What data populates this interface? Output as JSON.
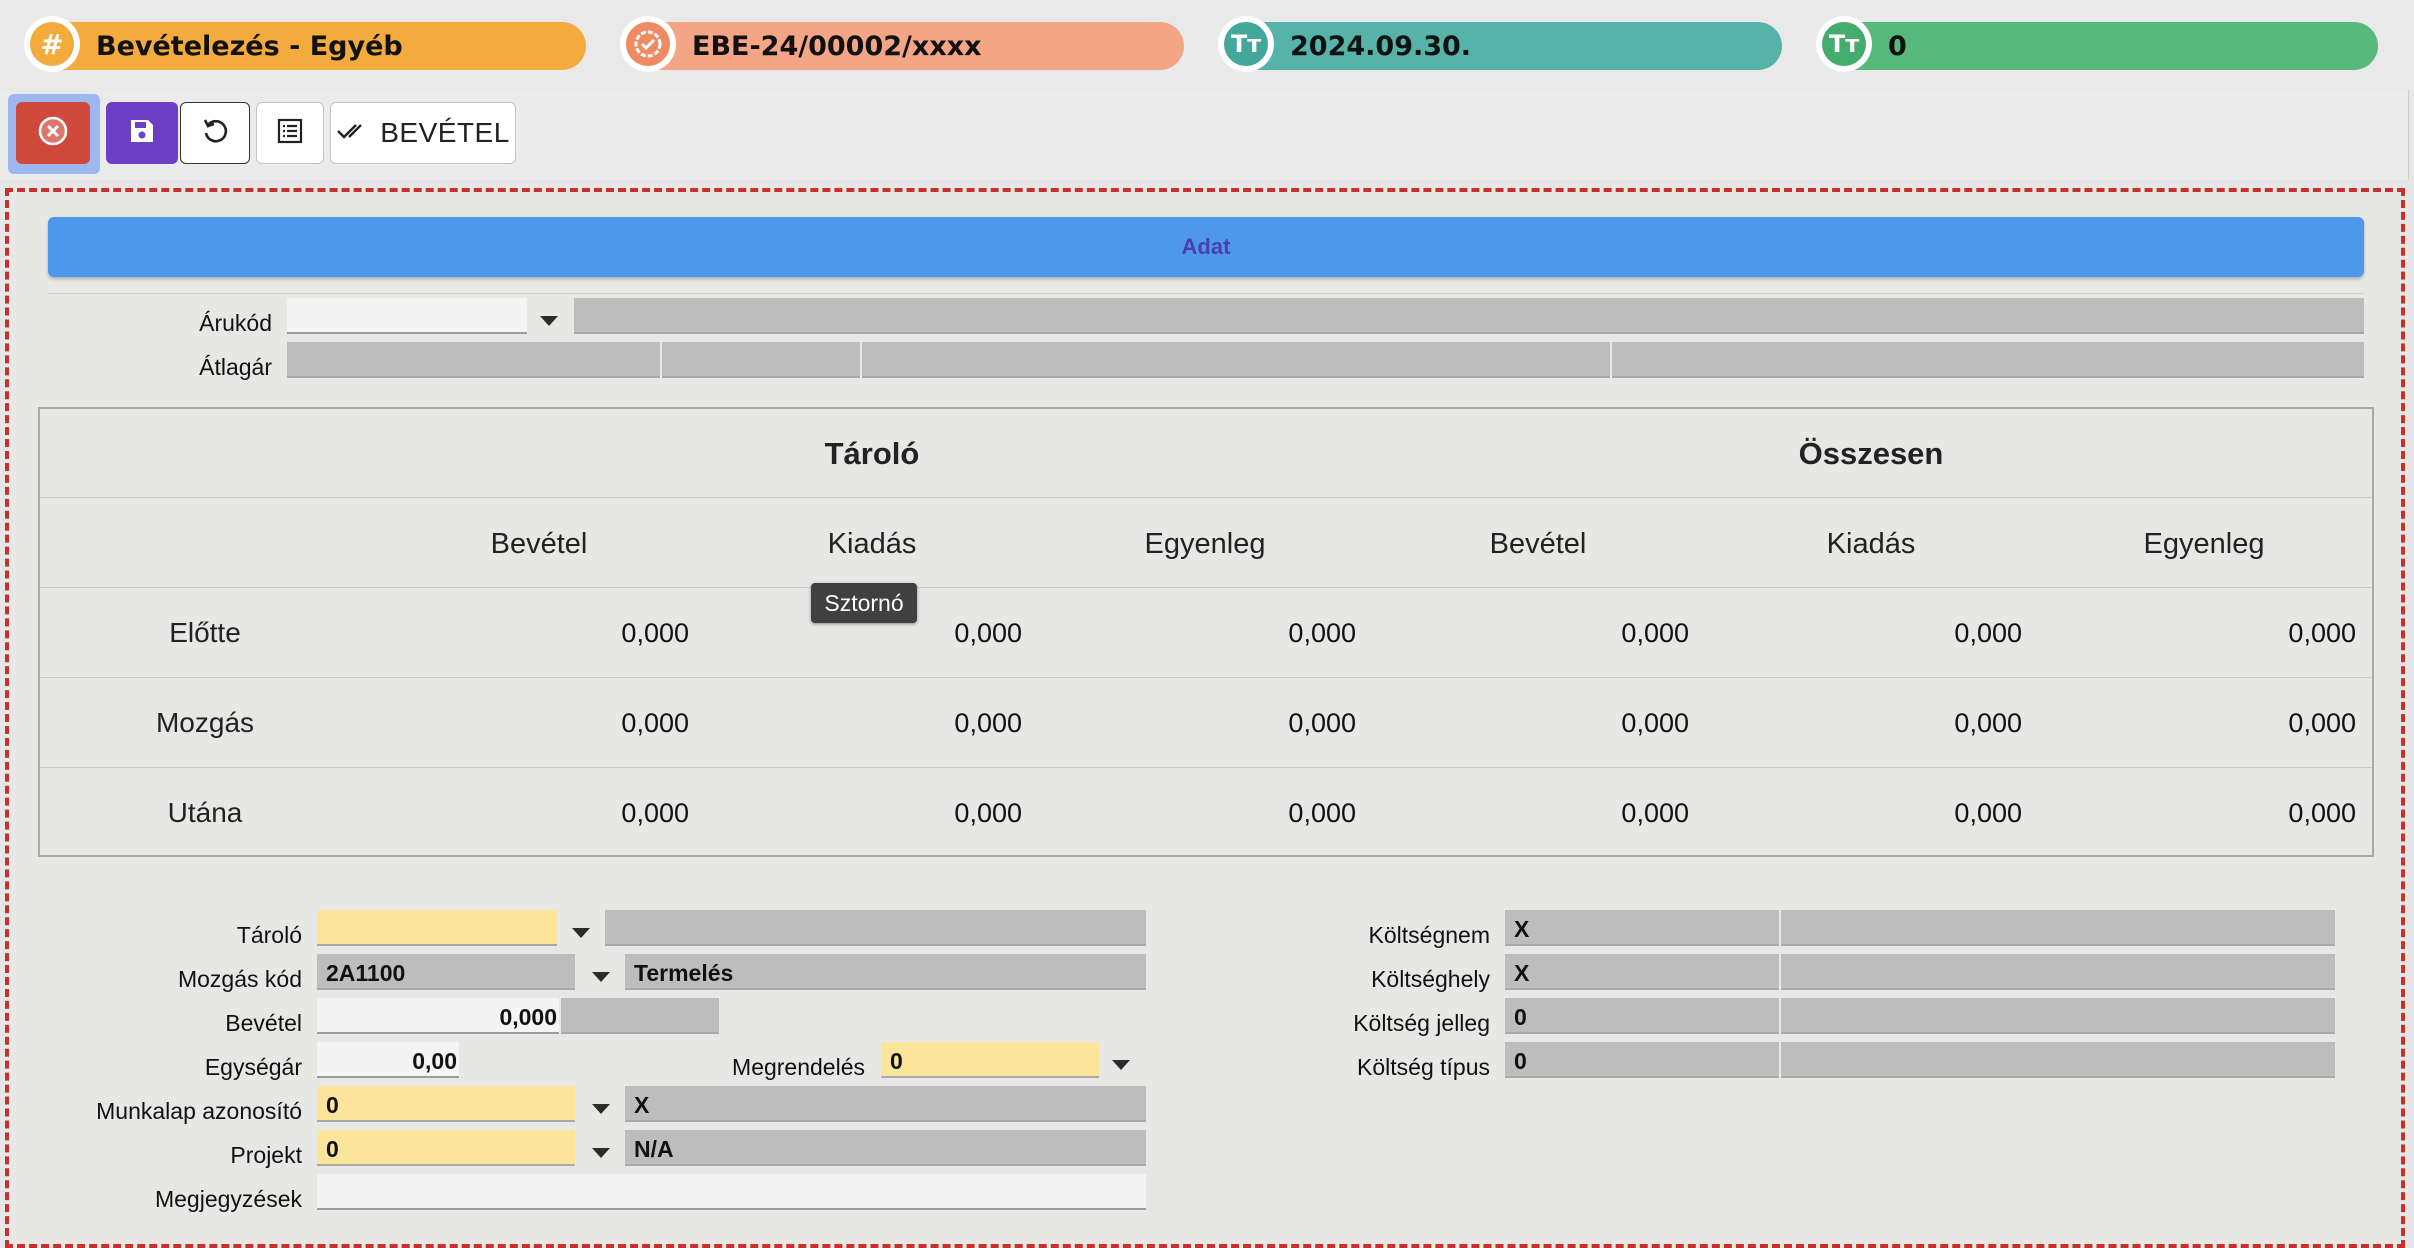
{
  "header": {
    "pills": [
      {
        "icon": "hash-icon",
        "text": "Bevételezés - Egyéb",
        "color": "#f2ab3c",
        "icon_color": "#f2ab3c",
        "glyph": "#"
      },
      {
        "icon": "check-badge-icon",
        "text": "EBE-24/00002/xxxx",
        "color": "#f3a585",
        "icon_color": "#f08a63",
        "glyph": "✓"
      },
      {
        "icon": "text-type-icon",
        "text": "2024.09.30.",
        "color": "#55b3a9",
        "icon_color": "#44a79b",
        "glyph": "Tт"
      },
      {
        "icon": "text-type-icon",
        "text": "0",
        "color": "#58b97c",
        "icon_color": "#44ad6b",
        "glyph": "Tт"
      }
    ]
  },
  "toolbar": {
    "cancel_icon": "close-circle-icon",
    "save_icon": "save-icon",
    "reset_icon": "undo-icon",
    "list_icon": "list-icon",
    "income_icon": "double-check-icon",
    "income_label": "BEVÉTEL",
    "tooltip": "Sztornó"
  },
  "section": {
    "title": "Adat"
  },
  "top_form": {
    "arukod_label": "Árukód",
    "atlagar_label": "Átlagár",
    "arukod_value": "",
    "arukod_desc": ""
  },
  "table": {
    "group_headers": [
      "Tároló",
      "Összesen"
    ],
    "sub_headers": [
      "Bevétel",
      "Kiadás",
      "Egyenleg",
      "Bevétel",
      "Kiadás",
      "Egyenleg"
    ],
    "rows": [
      {
        "label": "Előtte",
        "values": [
          "0,000",
          "0,000",
          "0,000",
          "0,000",
          "0,000",
          "0,000"
        ]
      },
      {
        "label": "Mozgás",
        "values": [
          "0,000",
          "0,000",
          "0,000",
          "0,000",
          "0,000",
          "0,000"
        ]
      },
      {
        "label": "Utána",
        "values": [
          "0,000",
          "0,000",
          "0,000",
          "0,000",
          "0,000",
          "0,000"
        ]
      }
    ]
  },
  "form": {
    "tarolo": {
      "label": "Tároló",
      "value": "",
      "desc": ""
    },
    "mozgas_kod": {
      "label": "Mozgás kód",
      "value": "2A1100",
      "desc": "Termelés"
    },
    "bevetel": {
      "label": "Bevétel",
      "value": "0,000"
    },
    "egysegar": {
      "label": "Egységár",
      "value": "0,00"
    },
    "megrendeles": {
      "label": "Megrendelés",
      "value": "0"
    },
    "munkalap": {
      "label": "Munkalap azonosító",
      "value": "0",
      "desc": "X"
    },
    "projekt": {
      "label": "Projekt",
      "value": "0",
      "desc": "N/A"
    },
    "megjegyzesek": {
      "label": "Megjegyzések",
      "value": ""
    },
    "koltsegnem": {
      "label": "Költségnem",
      "value": "X"
    },
    "koltseghely": {
      "label": "Költséghely",
      "value": "X"
    },
    "koltseg_jelleg": {
      "label": "Költség jelleg",
      "value": "0"
    },
    "koltseg_tipus": {
      "label": "Költség típus",
      "value": "0"
    }
  }
}
